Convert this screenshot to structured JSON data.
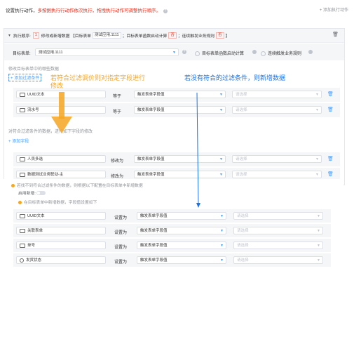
{
  "header": {
    "title": "设置执行动作，",
    "warning": "多按据执行行动作依次执行，拖拽执行动作可调整执行顺序。",
    "add_action": "添加执行动作"
  },
  "action": {
    "order_label": "执行顺序:",
    "order_value": "1",
    "summary_prefix": "修改或新增数据 【目标表单",
    "target_form": "测试应用.1111",
    "summary_mid": "；目标表单函数启动计算",
    "calc_flag": "否",
    "summary_mid2": "；连续触发业务规则",
    "rule_flag": "否",
    "summary_end": "】",
    "target_form_label": "目标表单:",
    "target_form_value": "测试应用.1111",
    "opt_calc": "目标表单函数启动计算",
    "opt_rule": "连续触发业务规则",
    "modify_section_label": "修改目标表单中的哪些数据",
    "add_filter": "添加过滤条件",
    "filters": [
      {
        "field": "UUID文本",
        "op": "等于",
        "value": "触发表单字段值",
        "placeholder": "请选择"
      },
      {
        "field": "流水号",
        "op": "等于",
        "value": "触发表单字段值",
        "placeholder": "请选择"
      }
    ],
    "modify_fields_label": "对符合过滤条件的数据，进行如下字段的修改",
    "add_field": "添加字段",
    "modify_fields": [
      {
        "field": "人员多选",
        "op": "修改为",
        "value": "触发表单字段值",
        "placeholder": "请选择"
      },
      {
        "field": "数据测试业务联动-主",
        "op": "修改为",
        "value": "触发表单字段值",
        "placeholder": "请选择"
      }
    ],
    "no_match_note": "若找不到符合过滤条件的数据，则根据以下配置在目标表单中新增数据",
    "enable_new_label": "启用新增:",
    "new_note": "在目标表单中新增数据，字段值设置如下",
    "new_fields": [
      {
        "field": "UUID文本",
        "op": "设置为",
        "value": "触发表单字段值",
        "placeholder": "请选择"
      },
      {
        "field": "关联表单",
        "op": "设置为",
        "value": "触发表单字段值",
        "placeholder": "请选择"
      },
      {
        "field": "单号",
        "op": "设置为",
        "value": "触发表单字段值",
        "placeholder": "请选择"
      },
      {
        "field": "发货状态",
        "op": "设置为",
        "value": "触发表单字段值",
        "placeholder": "请选择"
      }
    ]
  },
  "annotations": {
    "orange_text": "若符合过滤调价则对指定字段进行修改",
    "blue_text": "若没有符合的过滤条件，则新增数据"
  },
  "colors": {
    "accent": "#409eff",
    "annotation_orange": "#f5a623",
    "annotation_blue": "#1a73e8",
    "warning_red": "#e0301e"
  },
  "icons": {
    "add": "plus-icon",
    "delete": "trash-icon",
    "collapse": "triangle-down-icon",
    "help": "question-icon",
    "warning": "warning-circle-icon"
  }
}
